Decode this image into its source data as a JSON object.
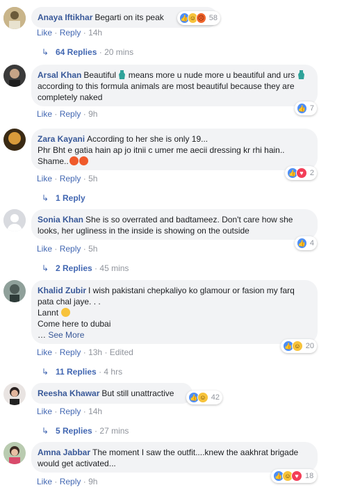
{
  "actions": {
    "like": "Like",
    "reply": "Reply",
    "sep": "·"
  },
  "comments": [
    {
      "author": "Anaya Iftikhar",
      "text": "Begarti on its peak",
      "time": "14h",
      "reactions": [
        "like",
        "haha",
        "angry"
      ],
      "count": "58",
      "replies": "64 Replies",
      "replies_time": "20 mins"
    },
    {
      "author": "Arsal Khan",
      "text_a": "Beautiful ",
      "text_b": " means more u nude more u beautiful and urs ",
      "text_c": " according to this formula animals are most beautiful because they are completely naked",
      "time": "9h",
      "reactions": [
        "like"
      ],
      "count": "7"
    },
    {
      "author": "Zara Kayani",
      "text": "According to her she is only 19...",
      "text2": "Phr Bht e gatia hain ap jo itnii c umer me aecii dressing kr rhi hain..",
      "text3": "Shame..",
      "time": "5h",
      "reactions": [
        "like",
        "love"
      ],
      "count": "2",
      "replies": "1 Reply",
      "replies_time": ""
    },
    {
      "author": "Sonia Khan",
      "text": "She is so overrated and badtameez. Don't care how she looks, her ugliness in the inside is showing on the outside",
      "time": "5h",
      "reactions": [
        "like"
      ],
      "count": "4",
      "replies": "2 Replies",
      "replies_time": "45 mins"
    },
    {
      "author": "Khalid Zubir",
      "text": "I wish pakistani chepkaliyo ko glamour or fasion my farq pata chal jaye. . .",
      "text2": "Lannt",
      "text3": "Come here to dubai",
      "see_more": "See More",
      "time": "13h",
      "edited": "Edited",
      "reactions": [
        "like",
        "haha"
      ],
      "count": "20",
      "replies": "11 Replies",
      "replies_time": "4 hrs"
    },
    {
      "author": "Reesha Khawar",
      "text": "But still unattractive",
      "time": "14h",
      "reactions": [
        "like",
        "haha"
      ],
      "count": "42",
      "replies": "5 Replies",
      "replies_time": "27 mins"
    },
    {
      "author": "Amna Jabbar",
      "text": "The moment I saw the outfit....knew the aakhrat brigade would get activated...",
      "time": "9h",
      "reactions": [
        "like",
        "haha",
        "love"
      ],
      "count": "18"
    }
  ],
  "colors": {
    "link": "#385898",
    "meta": "#90949c",
    "bubble": "#f2f3f5"
  }
}
